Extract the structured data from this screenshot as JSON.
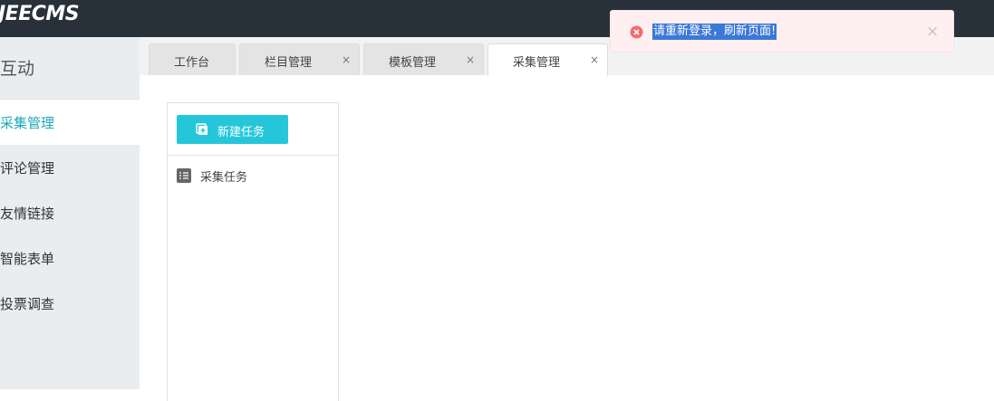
{
  "header": {
    "logo": "JEECMS"
  },
  "sidebar": {
    "section_title": "互动",
    "items": [
      {
        "label": "采集管理",
        "active": true
      },
      {
        "label": "评论管理"
      },
      {
        "label": "友情链接"
      },
      {
        "label": "智能表单"
      },
      {
        "label": "投票调查"
      }
    ]
  },
  "tabs": [
    {
      "label": "工作台",
      "closable": false
    },
    {
      "label": "栏目管理",
      "closable": true,
      "close": "×"
    },
    {
      "label": "模板管理",
      "closable": true,
      "close": "×"
    },
    {
      "label": "采集管理",
      "closable": true,
      "close": "×",
      "active": true
    }
  ],
  "panel": {
    "new_button": "新建任务",
    "tree": [
      {
        "label": "采集任务",
        "icon": "list-icon"
      }
    ]
  },
  "toast": {
    "message": "请重新登录，刷新页面!",
    "close": "×",
    "icon": "error-circle-icon",
    "colors": {
      "bg": "#fef0f0",
      "icon": "#f56c6c"
    }
  },
  "colors": {
    "topbar": "#28313a",
    "accent": "#26c6da",
    "active_text": "#1aa9b8",
    "sidebar": "#e9edf0"
  }
}
